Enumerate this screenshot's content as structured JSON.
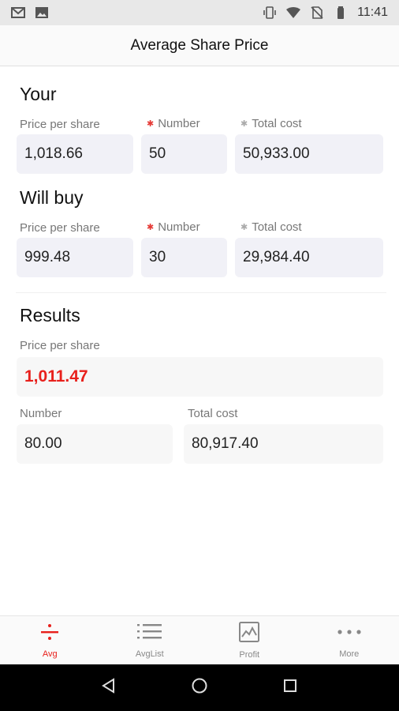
{
  "status_bar": {
    "time": "11:41",
    "left_icons": [
      "gmail-icon",
      "image-icon"
    ],
    "right_icons": [
      "vibrate-icon",
      "wifi-icon",
      "no-sim-icon",
      "battery-icon"
    ]
  },
  "header": {
    "title": "Average Share Price"
  },
  "your": {
    "title": "Your",
    "price_label": "Price per share",
    "number_label": "Number",
    "total_label": "Total cost",
    "price_value": "1,018.66",
    "number_value": "50",
    "total_value": "50,933.00"
  },
  "will_buy": {
    "title": "Will buy",
    "price_label": "Price per share",
    "number_label": "Number",
    "total_label": "Total cost",
    "price_value": "999.48",
    "number_value": "30",
    "total_value": "29,984.40"
  },
  "results": {
    "title": "Results",
    "price_label": "Price per share",
    "price_value": "1,011.47",
    "number_label": "Number",
    "number_value": "80.00",
    "total_label": "Total cost",
    "total_value": "80,917.40"
  },
  "bottom_nav": {
    "items": [
      {
        "label": "Avg",
        "icon": "divide-icon",
        "active": true
      },
      {
        "label": "AvgList",
        "icon": "list-icon",
        "active": false
      },
      {
        "label": "Profit",
        "icon": "chart-icon",
        "active": false
      },
      {
        "label": "More",
        "icon": "more-icon",
        "active": false
      }
    ]
  },
  "colors": {
    "accent": "#e8201c",
    "input_bg": "#f1f1f7",
    "result_bg": "#f7f7f7"
  }
}
